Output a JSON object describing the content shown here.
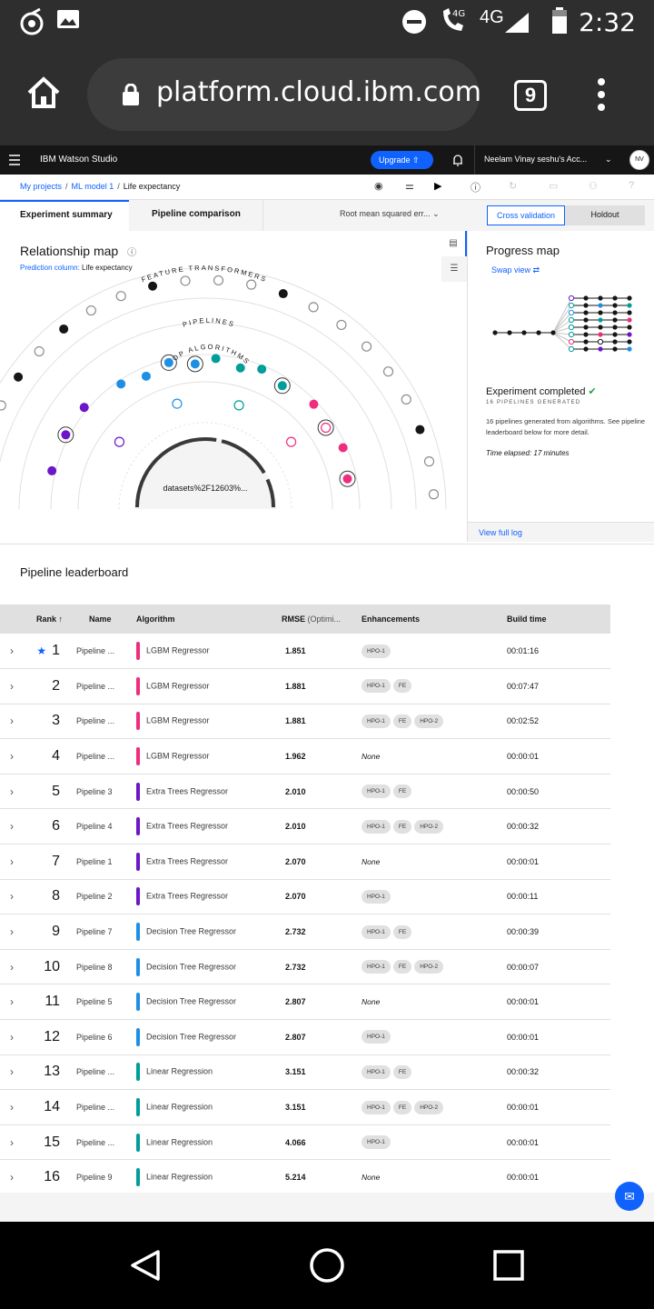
{
  "status": {
    "time": "2:32",
    "network": "4G",
    "call_net": "4G"
  },
  "browser": {
    "url": "platform.cloud.ibm.com",
    "tab_count": "9"
  },
  "app": {
    "brand": "IBM Watson Studio",
    "upgrade": "Upgrade",
    "account": "Neelam Vinay seshu's Acc...",
    "avatar": "NV"
  },
  "breadcrumb": {
    "c1": "My projects",
    "c2": "ML model 1",
    "c3": "Life expectancy"
  },
  "tabs": {
    "summary": "Experiment summary",
    "comparison": "Pipeline comparison",
    "metric": "Root mean squared err..."
  },
  "validation": {
    "cross": "Cross validation",
    "holdout": "Holdout"
  },
  "relationship": {
    "title": "Relationship map",
    "prediction_label": "Prediction column:",
    "prediction_value": "Life expectancy",
    "ring_features": "FEATURE TRANSFORMERS",
    "ring_pipelines": "PIPELINES",
    "ring_algorithms": "TOP ALGORITHMS",
    "dataset": "datasets%2F12603%..."
  },
  "progress": {
    "title": "Progress map",
    "swap": "Swap view",
    "completed": "Experiment completed",
    "generated": "16 PIPELINES GENERATED",
    "desc": "16 pipelines generated from algorithms. See pipeline leaderboard below for more detail.",
    "elapsed": "Time elapsed: 17 minutes",
    "log": "View full log"
  },
  "leaderboard": {
    "title": "Pipeline leaderboard",
    "headers": {
      "rank": "Rank",
      "name": "Name",
      "algorithm": "Algorithm",
      "rmse": "RMSE",
      "rmse_sub": "(Optimi...",
      "enh": "Enhancements",
      "build": "Build time"
    },
    "rows": [
      {
        "rank": "1",
        "name": "Pipeline ...",
        "alg": "LGBM Regressor",
        "color": "#ee2d7d",
        "rmse": "1.851",
        "enh": [
          "HPO-1"
        ],
        "time": "00:01:16",
        "star": true
      },
      {
        "rank": "2",
        "name": "Pipeline ...",
        "alg": "LGBM Regressor",
        "color": "#ee2d7d",
        "rmse": "1.881",
        "enh": [
          "HPO-1",
          "FE"
        ],
        "time": "00:07:47"
      },
      {
        "rank": "3",
        "name": "Pipeline ...",
        "alg": "LGBM Regressor",
        "color": "#ee2d7d",
        "rmse": "1.881",
        "enh": [
          "HPO-1",
          "FE",
          "HPO-2"
        ],
        "time": "00:02:52"
      },
      {
        "rank": "4",
        "name": "Pipeline ...",
        "alg": "LGBM Regressor",
        "color": "#ee2d7d",
        "rmse": "1.962",
        "enh": [],
        "time": "00:00:01"
      },
      {
        "rank": "5",
        "name": "Pipeline 3",
        "alg": "Extra Trees Regressor",
        "color": "#6d15c9",
        "rmse": "2.010",
        "enh": [
          "HPO-1",
          "FE"
        ],
        "time": "00:00:50"
      },
      {
        "rank": "6",
        "name": "Pipeline 4",
        "alg": "Extra Trees Regressor",
        "color": "#6d15c9",
        "rmse": "2.010",
        "enh": [
          "HPO-1",
          "FE",
          "HPO-2"
        ],
        "time": "00:00:32"
      },
      {
        "rank": "7",
        "name": "Pipeline 1",
        "alg": "Extra Trees Regressor",
        "color": "#6d15c9",
        "rmse": "2.070",
        "enh": [],
        "time": "00:00:01"
      },
      {
        "rank": "8",
        "name": "Pipeline 2",
        "alg": "Extra Trees Regressor",
        "color": "#6d15c9",
        "rmse": "2.070",
        "enh": [
          "HPO-1"
        ],
        "time": "00:00:11"
      },
      {
        "rank": "9",
        "name": "Pipeline 7",
        "alg": "Decision Tree Regressor",
        "color": "#1f8fe5",
        "rmse": "2.732",
        "enh": [
          "HPO-1",
          "FE"
        ],
        "time": "00:00:39"
      },
      {
        "rank": "10",
        "name": "Pipeline 8",
        "alg": "Decision Tree Regressor",
        "color": "#1f8fe5",
        "rmse": "2.732",
        "enh": [
          "HPO-1",
          "FE",
          "HPO-2"
        ],
        "time": "00:00:07"
      },
      {
        "rank": "11",
        "name": "Pipeline 5",
        "alg": "Decision Tree Regressor",
        "color": "#1f8fe5",
        "rmse": "2.807",
        "enh": [],
        "time": "00:00:01"
      },
      {
        "rank": "12",
        "name": "Pipeline 6",
        "alg": "Decision Tree Regressor",
        "color": "#1f8fe5",
        "rmse": "2.807",
        "enh": [
          "HPO-1"
        ],
        "time": "00:00:01"
      },
      {
        "rank": "13",
        "name": "Pipeline ...",
        "alg": "Linear Regression",
        "color": "#009d9a",
        "rmse": "3.151",
        "enh": [
          "HPO-1",
          "FE"
        ],
        "time": "00:00:32"
      },
      {
        "rank": "14",
        "name": "Pipeline ...",
        "alg": "Linear Regression",
        "color": "#009d9a",
        "rmse": "3.151",
        "enh": [
          "HPO-1",
          "FE",
          "HPO-2"
        ],
        "time": "00:00:01"
      },
      {
        "rank": "15",
        "name": "Pipeline ...",
        "alg": "Linear Regression",
        "color": "#009d9a",
        "rmse": "4.066",
        "enh": [
          "HPO-1"
        ],
        "time": "00:00:01"
      },
      {
        "rank": "16",
        "name": "Pipeline 9",
        "alg": "Linear Regression",
        "color": "#009d9a",
        "rmse": "5.214",
        "enh": [],
        "time": "00:00:01"
      }
    ],
    "none_label": "None"
  },
  "colors": {
    "accent": "#0f62fe",
    "pink": "#ee2d7d",
    "purple": "#6d15c9",
    "blue": "#1f8fe5",
    "teal": "#009d9a"
  }
}
